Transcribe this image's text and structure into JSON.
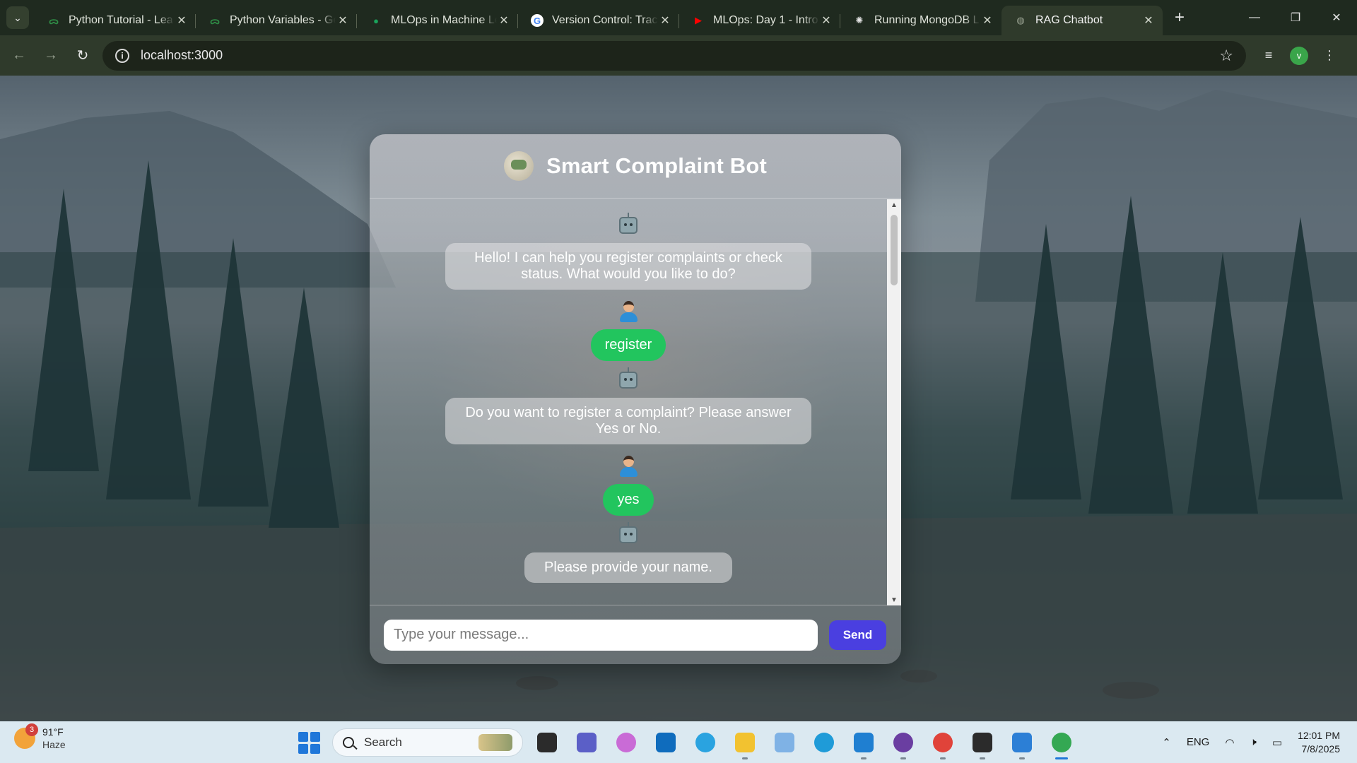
{
  "browser": {
    "tabs": [
      {
        "title": "Python Tutorial - Lea",
        "favicon": "geeksforgeeks-icon",
        "color": "#2f8d46",
        "active": false
      },
      {
        "title": "Python Variables - Ge",
        "favicon": "geeksforgeeks-icon",
        "color": "#2f8d46",
        "active": false
      },
      {
        "title": "MLOps in Machine Le",
        "favicon": "medium-icon",
        "color": "#1aa35b",
        "active": false
      },
      {
        "title": "Version Control: Trac",
        "favicon": "google-icon",
        "color": "#ffffff",
        "active": false
      },
      {
        "title": "MLOps: Day 1 - Intro",
        "favicon": "youtube-icon",
        "color": "#ff0000",
        "active": false
      },
      {
        "title": "Running MongoDB L",
        "favicon": "chatgpt-icon",
        "color": "#e6e6e6",
        "active": false
      },
      {
        "title": "RAG Chatbot",
        "favicon": "globe-icon",
        "color": "#9aa393",
        "active": true
      }
    ],
    "url": "localhost:3000",
    "profile_initial": "v"
  },
  "chat": {
    "title": "Smart Complaint Bot",
    "messages": [
      {
        "sender": "bot",
        "text": "Hello! I can help you register complaints or check status. What would you like to do?"
      },
      {
        "sender": "user",
        "text": "register"
      },
      {
        "sender": "bot",
        "text": "Do you want to register a complaint? Please answer Yes or No."
      },
      {
        "sender": "user",
        "text": "yes"
      },
      {
        "sender": "bot",
        "text": "Please provide your name."
      }
    ],
    "input_placeholder": "Type your message...",
    "send_label": "Send",
    "accent_user": "#22c55e",
    "accent_send": "#4a3fe0"
  },
  "taskbar": {
    "weather_temp": "91°F",
    "weather_cond": "Haze",
    "weather_badge": "3",
    "search_label": "Search",
    "apps": [
      {
        "name": "file-explorer-icon",
        "color": "#2b2b2b"
      },
      {
        "name": "teams-icon",
        "color": "#5b5fc7"
      },
      {
        "name": "copilot-icon",
        "color": "#c96bd6"
      },
      {
        "name": "outlook-icon",
        "color": "#0f6cbd"
      },
      {
        "name": "telegram-icon",
        "color": "#2aa3e0"
      },
      {
        "name": "folder-icon",
        "color": "#f2c230"
      },
      {
        "name": "gemini-icon",
        "color": "#7fb2e5"
      },
      {
        "name": "edge-icon",
        "color": "#1f9bd8"
      },
      {
        "name": "vscode-icon",
        "color": "#1f7fd1"
      },
      {
        "name": "github-desktop-icon",
        "color": "#6a3ea1"
      },
      {
        "name": "chrome-icon",
        "color": "#e0433a"
      },
      {
        "name": "terminal-icon",
        "color": "#2b2b2b"
      },
      {
        "name": "notepad-icon",
        "color": "#2c7fd6"
      },
      {
        "name": "chrome-active-icon",
        "color": "#34a853"
      }
    ],
    "lang": "ENG",
    "time": "12:01 PM",
    "date": "7/8/2025"
  }
}
